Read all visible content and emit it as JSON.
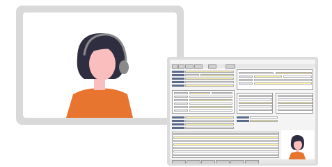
{
  "scene": {
    "colors": {
      "frame": "#d9d9d9",
      "hair": "#2f2e41",
      "skin": "#fbbebe",
      "shirt": "#e8752f",
      "headset": "#8a8a8a",
      "form_yellow": "#fff3a3",
      "form_label": "#5b6b8a"
    }
  },
  "video_call": {
    "participant_icon": "person-with-headset-icon"
  },
  "app_window": {
    "icon": "business-form-window-icon",
    "pip_icon": "person-pip-icon"
  }
}
